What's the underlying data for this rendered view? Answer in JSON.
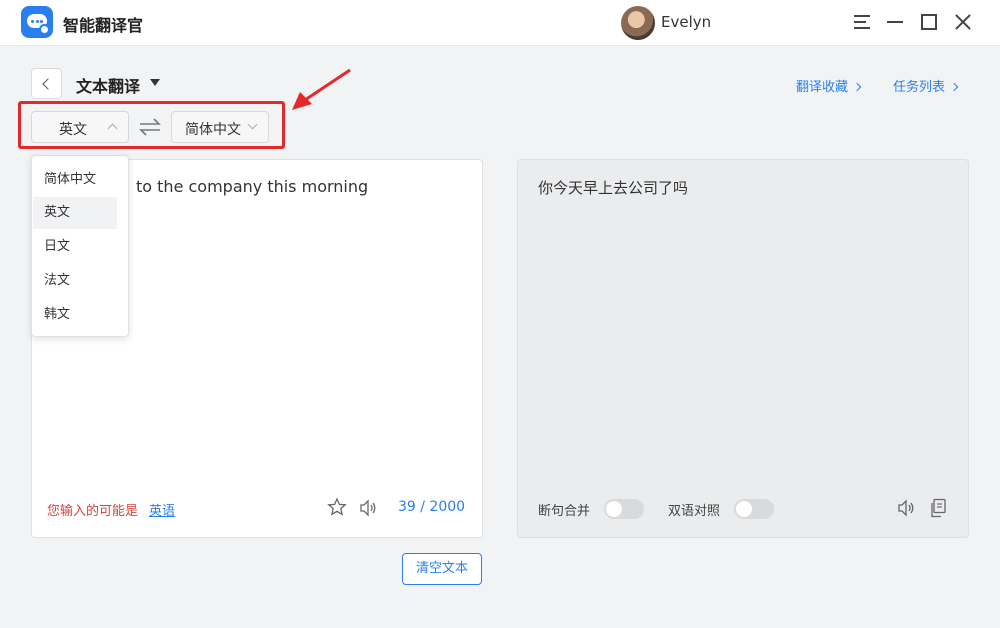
{
  "app": {
    "title": "智能翻译官",
    "logo_icon": "chat-bubble-icon",
    "user_name": "Evelyn"
  },
  "window_controls": [
    "menu-icon",
    "minimize-icon",
    "maximize-icon",
    "close-icon"
  ],
  "header": {
    "mode_title": "文本翻译",
    "links": {
      "favorites": "翻译收藏",
      "tasks": "任务列表"
    }
  },
  "lang_bar": {
    "source_lang": "英文",
    "target_lang": "简体中文",
    "swap_icon": "swap-arrows-icon"
  },
  "dropdown": {
    "options": [
      "简体中文",
      "英文",
      "日文",
      "法文",
      "韩文"
    ],
    "selected": "英文"
  },
  "source": {
    "visible_text": "to the company this morning",
    "detect_hint": "您输入的可能是",
    "detect_lang": "英语",
    "char_count": "39 / 2000"
  },
  "target": {
    "text": "你今天早上去公司了吗",
    "toggle_sentence_merge": {
      "label": "断句合并",
      "on": false
    },
    "toggle_bilingual": {
      "label": "双语对照",
      "on": false
    }
  },
  "actions": {
    "clear_text": "清空文本"
  },
  "colors": {
    "accent": "#2a7ff0",
    "highlight_red": "#e32a2a",
    "hint_red": "#d9433b"
  }
}
